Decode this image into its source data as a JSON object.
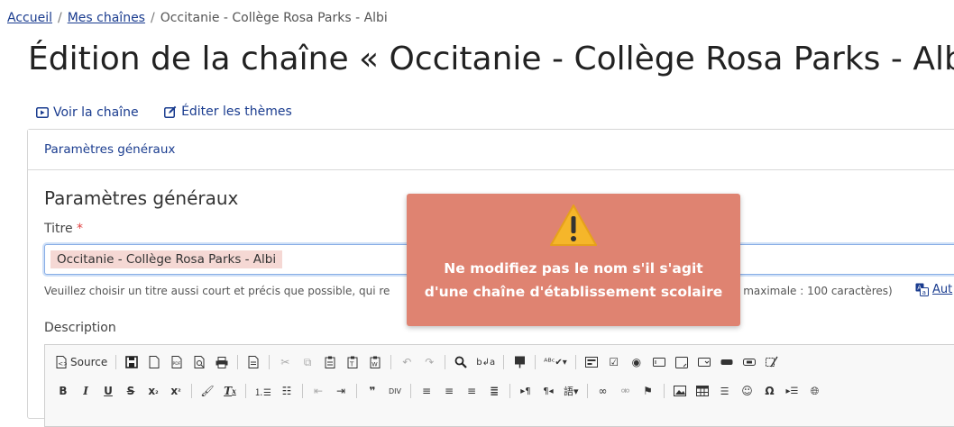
{
  "breadcrumb": {
    "items": [
      "Accueil",
      "Mes chaînes",
      "Occitanie - Collège Rosa Parks - Albi"
    ]
  },
  "page_title": "Édition de la chaîne « Occitanie - Collège Rosa Parks - Albi",
  "actions": {
    "view_channel": "Voir la chaîne",
    "edit_themes": "Éditer les thèmes"
  },
  "card": {
    "header": "Paramètres généraux",
    "section_title": "Paramètres généraux",
    "title_label": "Titre",
    "required_mark": "*",
    "title_value": "Occitanie - Collège Rosa Parks - Albi",
    "help_text": "Veuillez choisir un titre aussi court et précis que possible, qui re",
    "help_text_end": "e maximale : 100 caractères)",
    "auto_link": "Aut",
    "description_label": "Description"
  },
  "editor": {
    "source_label": "Source",
    "row1_icons": [
      "save-icon",
      "new-page-icon",
      "export-pdf-icon",
      "preview-icon",
      "print-icon",
      "templates-icon",
      "cut-icon",
      "copy-icon",
      "paste-icon",
      "paste-text-icon",
      "paste-word-icon",
      "undo-icon",
      "redo-icon",
      "find-icon",
      "replace-icon",
      "select-all-icon",
      "spellcheck-icon",
      "form-icon",
      "checkbox-icon",
      "radio-icon",
      "textfield-icon",
      "textarea-icon",
      "select-icon",
      "button-icon",
      "image-button-icon",
      "hidden-field-icon"
    ],
    "row2_icons": [
      "bold-icon",
      "italic-icon",
      "underline-icon",
      "strike-icon",
      "subscript-icon",
      "superscript-icon",
      "copy-format-icon",
      "remove-format-icon",
      "numbered-list-icon",
      "bulleted-list-icon",
      "outdent-icon",
      "indent-icon",
      "blockquote-icon",
      "div-icon",
      "align-left-icon",
      "align-center-icon",
      "align-right-icon",
      "justify-icon",
      "ltr-icon",
      "rtl-icon",
      "language-icon",
      "link-icon",
      "unlink-icon",
      "anchor-icon",
      "image-icon",
      "table-icon",
      "horizontal-rule-icon",
      "smiley-icon",
      "special-char-icon",
      "page-break-icon",
      "iframe-icon"
    ]
  },
  "overlay": {
    "line1": "Ne modifiez pas le nom s'il s'agit",
    "line2": "d'une chaîne d'établissement scolaire",
    "background": "#df8371"
  },
  "colors": {
    "link": "#1a3c8f",
    "warning_icon": "#f0b429"
  }
}
